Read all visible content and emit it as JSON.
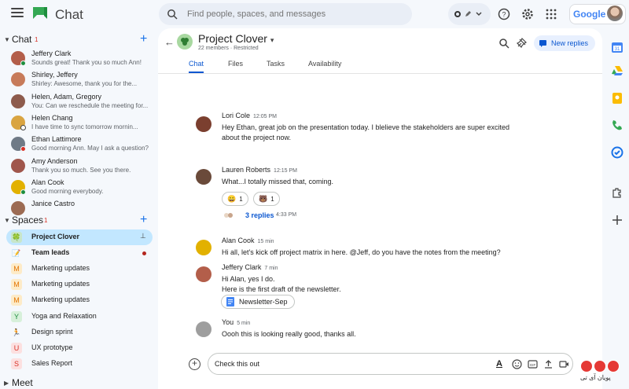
{
  "app": {
    "title": "Chat",
    "search_placeholder": "Find people, spaces, and messages",
    "google_label": "Google"
  },
  "sidebar": {
    "chat_header": "Chat",
    "chat_count": "1",
    "dms": [
      {
        "name": "Jeffery Clark",
        "preview": "Sounds great! Thank you so much Ann!",
        "avatar_color": "#b35e4a",
        "presence": "#1e8e3e"
      },
      {
        "name": "Shirley, Jeffery",
        "preview": "Shirley: Awesome, thank you for the...",
        "avatar_color": "#c77b5a",
        "presence": ""
      },
      {
        "name": "Helen, Adam, Gregory",
        "preview": "You: Can we reschedule the meeting for...",
        "avatar_color": "#8d5b4c",
        "presence": ""
      },
      {
        "name": "Helen Chang",
        "preview": "I have time to sync tomorrow mornin...",
        "avatar_color": "#d9a441",
        "presence": "#ffffff"
      },
      {
        "name": "Ethan Lattimore",
        "preview": "Good morning Ann. May I ask a question?",
        "avatar_color": "#6f7a86",
        "presence": "#d93025"
      },
      {
        "name": "Amy Anderson",
        "preview": "Thank you so much. See you there.",
        "avatar_color": "#a0564c",
        "presence": ""
      },
      {
        "name": "Alan Cook",
        "preview": "Good morning everybody.",
        "avatar_color": "#e2b100",
        "presence": "#1e8e3e"
      },
      {
        "name": "Janice Castro",
        "preview": "",
        "avatar_color": "#9c6b53",
        "presence": ""
      }
    ],
    "spaces_header": "Spaces",
    "spaces_count": "1",
    "spaces": [
      {
        "label": "Project Clover",
        "icon": "🍀",
        "icon_bg": "#c8e6c9",
        "icon_color": "#2e7d32",
        "active": true,
        "bold": true
      },
      {
        "label": "Team leads",
        "icon": "📝",
        "icon_bg": "transparent",
        "icon_color": "#d93025",
        "active": false,
        "bold": true
      },
      {
        "label": "Marketing updates",
        "icon": "M",
        "icon_bg": "#fdebc8",
        "icon_color": "#e37400",
        "active": false,
        "bold": false
      },
      {
        "label": "Marketing updates",
        "icon": "M",
        "icon_bg": "#fdebc8",
        "icon_color": "#e37400",
        "active": false,
        "bold": false
      },
      {
        "label": "Marketing updates",
        "icon": "M",
        "icon_bg": "#fdebc8",
        "icon_color": "#e37400",
        "active": false,
        "bold": false
      },
      {
        "label": "Yoga and Relaxation",
        "icon": "Y",
        "icon_bg": "#d7f0da",
        "icon_color": "#1e8e3e",
        "active": false,
        "bold": false
      },
      {
        "label": "Design sprint",
        "icon": "🏃",
        "icon_bg": "transparent",
        "icon_color": "#5f6368",
        "active": false,
        "bold": false
      },
      {
        "label": "UX prototype",
        "icon": "U",
        "icon_bg": "#fce0e0",
        "icon_color": "#d93025",
        "active": false,
        "bold": false
      },
      {
        "label": "Sales Report",
        "icon": "S",
        "icon_bg": "#fce0e0",
        "icon_color": "#d93025",
        "active": false,
        "bold": false
      }
    ],
    "meet_header": "Meet"
  },
  "space": {
    "title": "Project Clover",
    "subtitle": "22 members · Restricted",
    "new_replies": "New replies",
    "tabs": [
      "Chat",
      "Files",
      "Tasks",
      "Availability"
    ]
  },
  "messages": [
    {
      "name": "Lori Cole",
      "time": "12:05 PM",
      "lines": [
        "Hey Ethan, great job on the presentation today. I blelieve the stakeholders are super excited",
        "about the project now."
      ],
      "avatar_color": "#7b3f2f"
    },
    {
      "name": "Lauren Roberts",
      "time": "12:15 PM",
      "lines": [
        "What...I totally missed that, coming."
      ],
      "avatar_color": "#6a4a3a"
    },
    {
      "name": "Alan Cook",
      "time": "15 min",
      "lines": [
        "Hi all, let's kick off project matrix in here. @Jeff, do you have the notes from the meeting?"
      ],
      "avatar_color": "#e2b100"
    },
    {
      "name": "Jeffery Clark",
      "time": "7 min",
      "lines": [
        "Hi Alan, yes I do.",
        "Here is the first draft of the newsletter."
      ],
      "avatar_color": "#b35e4a"
    },
    {
      "name": "You",
      "time": "5 min",
      "lines": [
        "Oooh this is looking really good, thanks all."
      ],
      "avatar_color": "#9e9e9e"
    }
  ],
  "reactions": [
    {
      "emoji": "😀",
      "count": "1"
    },
    {
      "emoji": "🐻",
      "count": "1"
    }
  ],
  "thread": {
    "label": "3 replies",
    "time": "4:33 PM"
  },
  "attachment": {
    "label": "Newsletter-Sep"
  },
  "composer": {
    "value": "Check this out"
  },
  "watermark": {
    "text": "پویان آی تی"
  }
}
